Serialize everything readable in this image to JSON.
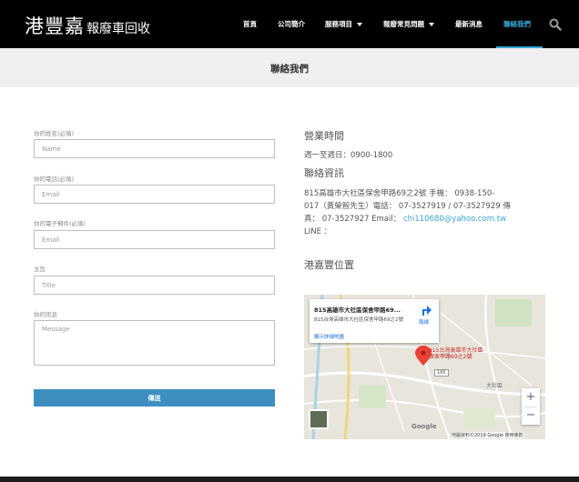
{
  "header": {
    "logo_main": "港豐嘉",
    "logo_sub": "報廢車回收",
    "nav": [
      {
        "label": "首頁"
      },
      {
        "label": "公司簡介"
      },
      {
        "label": "服務項目"
      },
      {
        "label": "報廢常見問題"
      },
      {
        "label": "最新消息"
      },
      {
        "label": "聯絡我們",
        "active": true
      }
    ],
    "search_icon": "search-icon",
    "accent_color": "#35a7d6"
  },
  "page_title": "聯絡我們",
  "form": {
    "fields": [
      {
        "label": "你的姓名(必填)",
        "placeholder": "Name"
      },
      {
        "label": "你的電話(必填)",
        "placeholder": "Email"
      },
      {
        "label": "你的電子郵件(必填)",
        "placeholder": "Email"
      },
      {
        "label": "主旨",
        "placeholder": "Title"
      },
      {
        "label": "你的訊息",
        "placeholder": "Message"
      }
    ],
    "submit_label": "傳送",
    "button_color": "#3e8fc0"
  },
  "info": {
    "hours_title": "營業時間",
    "hours_text": "週一至週日：0900-1800",
    "contact_title": "聯絡資訊",
    "contact_line1": "815高雄市大社區保舍甲路69之2號 手機： 0938-150-",
    "contact_line2": "017（黃榮智先生）電話： 07-3527919 / 07-3527929 傳",
    "contact_line3_prefix": "真： 07-3527927 Email：",
    "email": "chi110680@yahoo.com.tw",
    "contact_line4": "LINE ：",
    "location_title": "港嘉豐位置"
  },
  "map": {
    "card_title": "815高雄市大社區保舍甲路69...",
    "card_address": "815台灣高雄市大社區保舍甲路69之2號",
    "card_link": "顯示詳細地圖",
    "directions_label": "路線",
    "pin_label_line1": "815台灣高雄市大社區",
    "pin_label_line2": "保舍甲路69之2號",
    "road_number": "186",
    "place_label": "大社區",
    "zoom_in": "+",
    "zoom_out": "−",
    "google_label": "Google",
    "attribution": "地圖資料©2019 Google   使用條款"
  }
}
